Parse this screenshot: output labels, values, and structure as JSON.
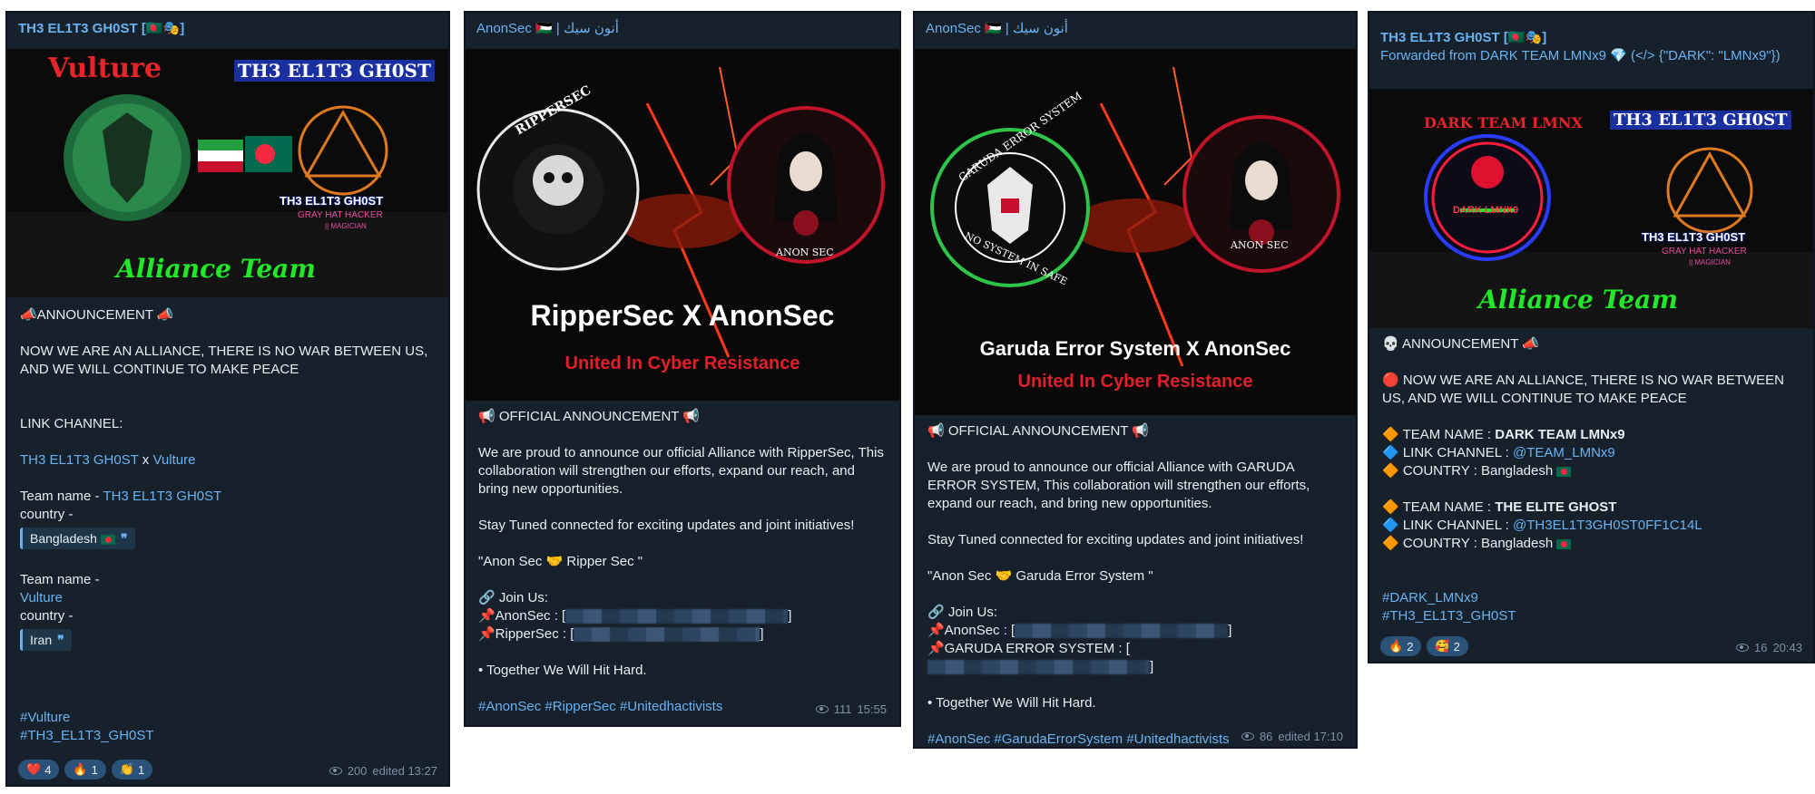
{
  "card1": {
    "channel": "TH3 EL1T3 GH0ST [🇧🇩🎭]",
    "banner": {
      "left_title": "Vulture",
      "right_title": "TH3 EL1T3 GH0ST",
      "logo_title": "TH3 EL1T3 GH0ST",
      "logo_sub": "GRAY HAT HACKER",
      "logo_sub2": "|| MAGICIAN",
      "bottom": "Alliance Team"
    },
    "announcement": "📣ANNOUNCEMENT 📣",
    "message": "NOW WE ARE AN ALLIANCE, THERE IS NO WAR BETWEEN US, AND WE WILL CONTINUE TO MAKE PEACE",
    "link_channel_label": "LINK CHANNEL:",
    "link_a": "TH3 EL1T3 GH0ST",
    "link_x": " x ",
    "link_b": "Vulture",
    "team1_label": "Team name - ",
    "team1_name": "TH3 EL1T3 GH0ST",
    "country1_label": "country -",
    "country1": "Bangladesh",
    "team2_label": "Team name -",
    "team2_name": "Vulture",
    "country2_label": " country -",
    "country2": "Iran",
    "hashtag1": "#Vulture",
    "hashtag2": "#TH3_EL1T3_GH0ST",
    "reactions": [
      {
        "emoji": "❤️",
        "count": "4"
      },
      {
        "emoji": "🔥",
        "count": "1"
      },
      {
        "emoji": "👏",
        "count": "1"
      }
    ],
    "views": "200",
    "time": "edited 13:27"
  },
  "card2": {
    "channel": "AnonSec 🇵🇸 | أنون سيك",
    "banner": {
      "left_logo": "RIPPERSEC",
      "right_logo": "ANON SEC",
      "title": "RipperSec X AnonSec",
      "subtitle": "United In Cyber Resistance"
    },
    "announcement": "📢 OFFICIAL ANNOUNCEMENT 📢",
    "message": "We are proud to announce our official Alliance with RipperSec, This collaboration will strengthen our efforts, expand our reach, and bring new opportunities.",
    "stay": "Stay Tuned connected for exciting updates and joint initiatives!",
    "quote": "\"Anon Sec  🤝  Ripper Sec \"",
    "join": "🔗 Join Us:",
    "l1": "📌AnonSec : [",
    "l2": "📌RipperSec : [",
    "close": "]",
    "together": "• Together We Will Hit Hard.",
    "hashtags": "#AnonSec #RipperSec #Unitedhactivists",
    "views": "111",
    "time": "15:55"
  },
  "card3": {
    "channel": "AnonSec 🇵🇸 | أنون سيك",
    "banner": {
      "left_logo": "GARUDA ERROR SYSTEM",
      "left_logo2": "NO SYSTEM IN SAFE",
      "right_logo": "ANON SEC",
      "title": "Garuda Error System X AnonSec",
      "subtitle": "United In Cyber Resistance"
    },
    "announcement": "📢 OFFICIAL ANNOUNCEMENT 📢",
    "message": "We are proud to announce our official Alliance with GARUDA ERROR SYSTEM, This collaboration will strengthen our efforts, expand our reach, and bring new opportunities.",
    "stay": "Stay Tuned connected for exciting updates and joint initiatives!",
    "quote": "\"Anon Sec  🤝  Garuda Error System \"",
    "join": "🔗 Join Us:",
    "l1": "📌AnonSec : [",
    "l2": "📌GARUDA ERROR SYSTEM : [",
    "close": "]",
    "together": "• Together We Will Hit Hard.",
    "hashtags": "#AnonSec #GarudaErrorSystem #Unitedhactivists",
    "views": "86",
    "time": "edited 17:10"
  },
  "card4": {
    "channel": "TH3 EL1T3 GH0ST [🇧🇩🎭]",
    "forwarded_prefix": "Forwarded from ",
    "forwarded_name": "DARK TEAM LMNx9 💎 (</> {\"DARK\": \"LMNx9\"})",
    "banner": {
      "left_title": "DARK TEAM LMNX",
      "left_logo": "DARK LMNX9",
      "right_title": "TH3 EL1T3 GH0ST",
      "logo_title": "TH3 EL1T3 GH0ST",
      "logo_sub": "GRAY HAT HACKER",
      "logo_sub2": "|| MAGICIAN",
      "bottom": "Alliance Team"
    },
    "announcement": "💀 ANNOUNCEMENT 📣",
    "message": "🔴 NOW WE ARE AN ALLIANCE, THERE IS NO WAR BETWEEN US, AND WE WILL CONTINUE TO MAKE PEACE",
    "t1_label": "🔶 TEAM NAME : ",
    "t1_name": "DARK TEAM LMNx9",
    "t1_link_label": "🔷 LINK CHANNEL : ",
    "t1_link": "@TEAM_LMNx9",
    "t1_country_label": "🔶 COUNTRY : Bangladesh",
    "t2_label": "🔶 TEAM NAME : ",
    "t2_name": "THE ELITE GHOST",
    "t2_link_label": "🔷 LINK CHANNEL : ",
    "t2_link": "@TH3EL1T3GH0ST0FF1C14L",
    "t2_country_label": "🔶 COUNTRY : Bangladesh",
    "hashtag1": "#DARK_LMNx9",
    "hashtag2": "#TH3_EL1T3_GH0ST",
    "reactions": [
      {
        "emoji": "🔥",
        "count": "2"
      },
      {
        "emoji": "🥰",
        "count": "2"
      }
    ],
    "views": "16",
    "time": "20:43"
  }
}
